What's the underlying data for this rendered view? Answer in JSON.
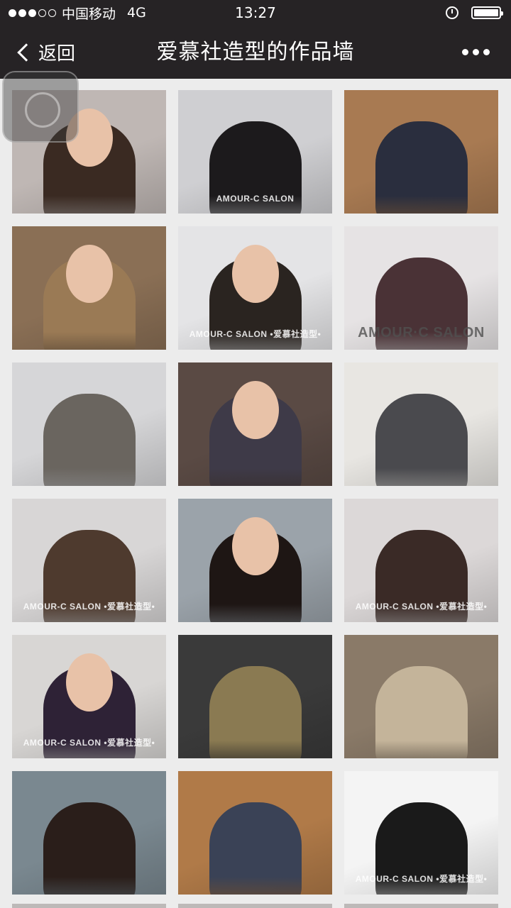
{
  "status_bar": {
    "carrier": "中国移动",
    "network": "4G",
    "time": "13:27",
    "signal_bars_filled": 3,
    "signal_bars_total": 5,
    "battery_level": 1.0
  },
  "nav": {
    "back_label": "返回",
    "title": "爱慕社造型的作品墙"
  },
  "gallery": {
    "tiles": [
      {
        "bg": "#bfb7b4",
        "hair": "#3a2a22",
        "face": true,
        "watermark": ""
      },
      {
        "bg": "#cfcfd2",
        "hair": "#1c1a1c",
        "face": false,
        "watermark": "AMOUR-C SALON"
      },
      {
        "bg": "#a87a52",
        "hair": "#2a2e3e",
        "face": false,
        "watermark": ""
      },
      {
        "bg": "#8a6f55",
        "hair": "#9a7a55",
        "face": true,
        "watermark": ""
      },
      {
        "bg": "#e4e4e6",
        "hair": "#2a2420",
        "face": true,
        "watermark": "AMOUR-C SALON •爱慕社造型•"
      },
      {
        "bg": "#e6e3e4",
        "hair": "#4a3236",
        "face": false,
        "watermark": "AMOUR·C SALON"
      },
      {
        "bg": "#d6d6d8",
        "hair": "#6a655f",
        "face": false,
        "watermark": ""
      },
      {
        "bg": "#5a4a44",
        "hair": "#3e3a48",
        "face": true,
        "watermark": ""
      },
      {
        "bg": "#e8e6e2",
        "hair": "#4a4a4e",
        "face": false,
        "watermark": ""
      },
      {
        "bg": "#d8d6d6",
        "hair": "#4e3a2e",
        "face": false,
        "watermark": "AMOUR-C SALON •爱慕社造型•"
      },
      {
        "bg": "#9ba3aa",
        "hair": "#1e1614",
        "face": true,
        "watermark": ""
      },
      {
        "bg": "#dcd8d8",
        "hair": "#3a2a26",
        "face": false,
        "watermark": "AMOUR-C SALON •爱慕社造型•"
      },
      {
        "bg": "#d8d6d4",
        "hair": "#2e2236",
        "face": true,
        "watermark": "AMOUR-C SALON •爱慕社造型•"
      },
      {
        "bg": "#3a3a3a",
        "hair": "#8a7a52",
        "face": false,
        "watermark": ""
      },
      {
        "bg": "#8a7a68",
        "hair": "#c4b49a",
        "face": false,
        "watermark": ""
      },
      {
        "bg": "#7a8890",
        "hair": "#2a1e1a",
        "face": false,
        "watermark": ""
      },
      {
        "bg": "#b07a48",
        "hair": "#3a4256",
        "face": false,
        "watermark": ""
      },
      {
        "bg": "#f4f4f4",
        "hair": "#1a1a1a",
        "face": false,
        "watermark": "AMOUR-C SALON •爱慕社造型•"
      }
    ]
  },
  "icons": {
    "back": "chevron-left-icon",
    "more": "more-dots-icon",
    "alarm": "alarm-clock-icon",
    "battery": "battery-icon"
  }
}
